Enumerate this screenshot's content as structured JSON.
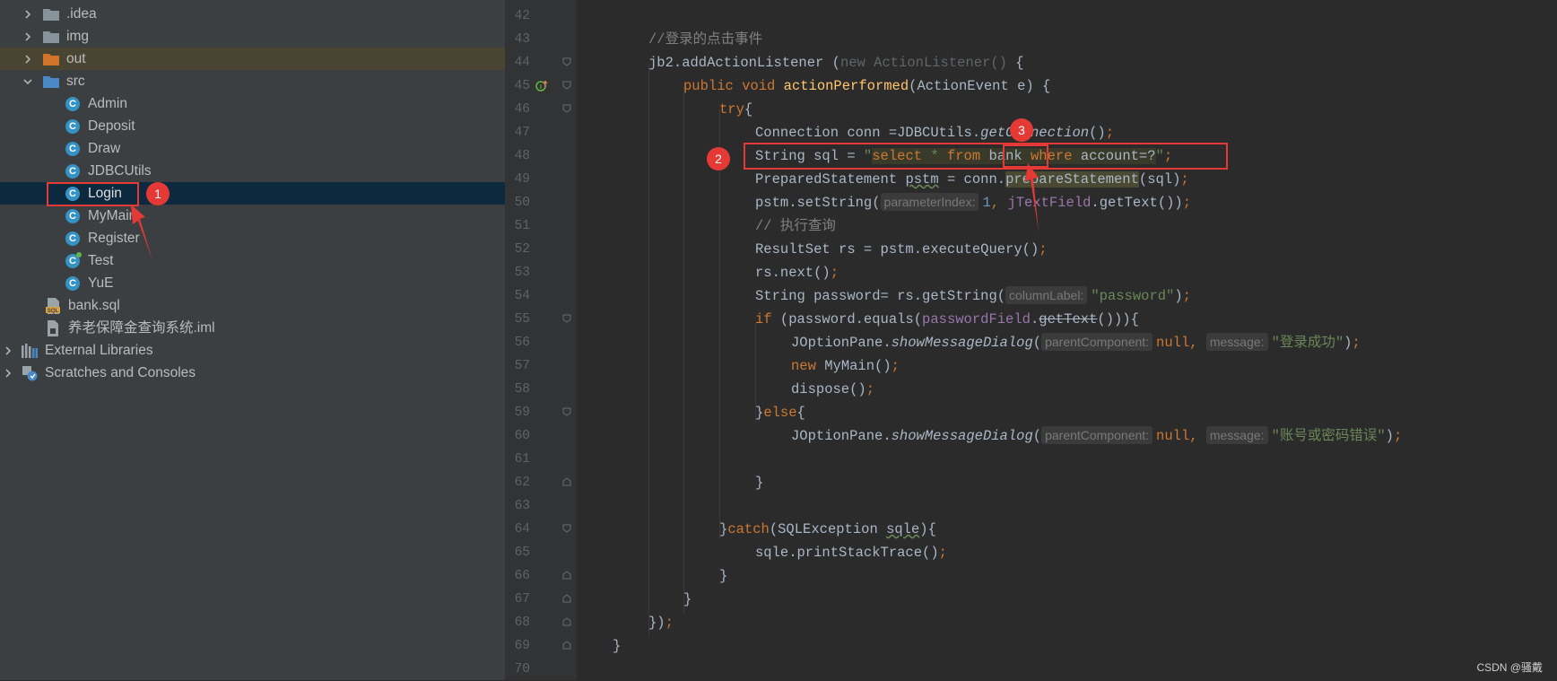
{
  "project_tree": {
    "items": [
      {
        "label": ".idea",
        "icon": "folder-icon"
      },
      {
        "label": "img",
        "icon": "folder-icon"
      },
      {
        "label": "out",
        "icon": "folder-icon"
      },
      {
        "label": "src",
        "icon": "folder-icon"
      },
      {
        "label": "Admin",
        "icon": "class-icon",
        "icon_glyph": "C"
      },
      {
        "label": "Deposit",
        "icon": "class-icon",
        "icon_glyph": "C"
      },
      {
        "label": "Draw",
        "icon": "class-icon",
        "icon_glyph": "C"
      },
      {
        "label": "JDBCUtils",
        "icon": "class-icon",
        "icon_glyph": "C"
      },
      {
        "label": "Login",
        "icon": "class-icon",
        "icon_glyph": "C"
      },
      {
        "label": "MyMain",
        "icon": "class-icon",
        "icon_glyph": "C"
      },
      {
        "label": "Register",
        "icon": "class-icon",
        "icon_glyph": "C"
      },
      {
        "label": "Test",
        "icon": "class-icon",
        "icon_glyph": "C"
      },
      {
        "label": "YuE",
        "icon": "class-icon",
        "icon_glyph": "C"
      },
      {
        "label": "bank.sql",
        "icon": "sql-file-icon"
      },
      {
        "label": "养老保障金查询系统.iml",
        "icon": "iml-file-icon"
      },
      {
        "label": "External Libraries",
        "icon": "library-icon"
      },
      {
        "label": "Scratches and Consoles",
        "icon": "scratches-icon"
      }
    ]
  },
  "editor": {
    "line_numbers": [
      "42",
      "43",
      "44",
      "45",
      "46",
      "47",
      "48",
      "49",
      "50",
      "51",
      "52",
      "53",
      "54",
      "55",
      "56",
      "57",
      "58",
      "59",
      "60",
      "61",
      "62",
      "63",
      "64",
      "65",
      "66",
      "67",
      "68",
      "69",
      "70"
    ],
    "tokens": {
      "l43_comment": "//登录的点击事件",
      "l44_a": "jb2.addActionListener (",
      "l44_new": "new ActionListener()",
      "l44_b": " {",
      "l45_kw": "public void ",
      "l45_fn": "actionPerformed",
      "l45_b": "(ActionEvent e) {",
      "l46_kw": "try",
      "l46_b": "{",
      "l47_a": "Connection conn =JDBCUtils.",
      "l47_it": "getConnection",
      "l47_b": "()",
      "l47_semi": ";",
      "l48_a": "String sql = ",
      "l48_q1": "\"",
      "l48_select": "select",
      "l48_star": " * ",
      "l48_from": "from",
      "l48_sp": " ",
      "l48_bank": "bank",
      "l48_where": " where",
      "l48_acc": " account=?",
      "l48_q2": "\"",
      "l48_semi": ";",
      "l49_a": "PreparedStatement ",
      "l49_pstm": "pstm",
      "l49_b": " = conn.",
      "l49_hl": "prepareStatement",
      "l49_c": "(sql)",
      "l49_semi": ";",
      "l50_a": "pstm.setString(",
      "l50_hint": "parameterIndex:",
      "l50_num": "1",
      "l50_comma": ", ",
      "l50_fld": "jTextField",
      "l50_b": ".getText())",
      "l50_semi": ";",
      "l51_comment": "// 执行查询",
      "l52_a": "ResultSet rs = pstm.executeQuery()",
      "l52_semi": ";",
      "l53_a": "rs.next()",
      "l53_semi": ";",
      "l54_a": "String password= rs.getString(",
      "l54_hint": "columnLabel:",
      "l54_str": "\"password\"",
      "l54_b": ")",
      "l54_semi": ";",
      "l55_kw": "if ",
      "l55_a": "(password.equals(",
      "l55_fld": "passwordField",
      "l55_b": ".",
      "l55_strike": "getText",
      "l55_c": "())){",
      "l56_a": "JOptionPane.",
      "l56_it": "showMessageDialog",
      "l56_b": "(",
      "l56_hint1": "parentComponent:",
      "l56_null": "null, ",
      "l56_hint2": "message:",
      "l56_str": "\"登录成功\"",
      "l56_c": ")",
      "l56_semi": ";",
      "l57_kw": "new ",
      "l57_a": "MyMain()",
      "l57_semi": ";",
      "l58_a": "dispose()",
      "l58_semi": ";",
      "l59_a": "}",
      "l59_kw": "else",
      "l59_b": "{",
      "l60_a": "JOptionPane.",
      "l60_it": "showMessageDialog",
      "l60_b": "(",
      "l60_hint1": "parentComponent:",
      "l60_null": "null, ",
      "l60_hint2": "message:",
      "l60_str": "\"账号或密码错误\"",
      "l60_c": ")",
      "l60_semi": ";",
      "l62_a": "}",
      "l64_a": "}",
      "l64_kw": "catch",
      "l64_b": "(SQLException ",
      "l64_sqle": "sqle",
      "l64_c": "){",
      "l65_a": "sqle.printStackTrace()",
      "l65_semi": ";",
      "l66_a": "}",
      "l67_a": "}",
      "l68_a": "})",
      "l68_semi": ";",
      "l69_a": "}"
    }
  },
  "annotations": {
    "badge_1": "1",
    "badge_2": "2",
    "badge_3": "3"
  },
  "watermark": "CSDN @骚戴",
  "colors": {
    "sidebar_bg": "#3c3f41",
    "editor_bg": "#2b2b2b",
    "selection": "#0d293e",
    "keyword": "#cc7832",
    "string": "#6a8759",
    "method": "#ffc66d",
    "field": "#9876aa",
    "comment": "#808080",
    "annotation_red": "#e53935"
  }
}
